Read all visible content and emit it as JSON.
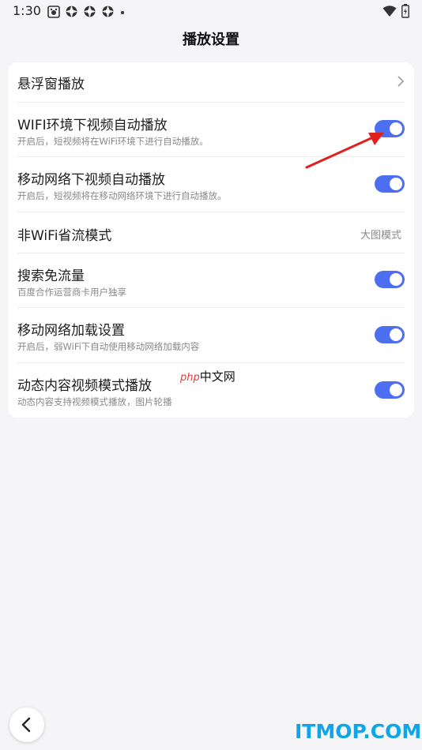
{
  "status_bar": {
    "time": "1:30",
    "icons": [
      "app-notification-icon",
      "gear-notification-icon",
      "gear-notification-icon",
      "gear-notification-icon",
      "more-dot-icon"
    ],
    "right_icons": [
      "wifi-icon",
      "battery-icon"
    ]
  },
  "header": {
    "title": "播放设置"
  },
  "settings": {
    "floating_window": {
      "title": "悬浮窗播放"
    },
    "wifi_autoplay": {
      "title": "WIFI环境下视频自动播放",
      "subtitle": "开启后，短视频将在WiFi环境下进行自动播放。",
      "enabled": true
    },
    "mobile_autoplay": {
      "title": "移动网络下视频自动播放",
      "subtitle": "开启后，短视频将在移动网络环境下进行自动播放。",
      "enabled": true
    },
    "data_saving": {
      "title": "非WiFi省流模式",
      "value": "大图模式"
    },
    "search_free_data": {
      "title": "搜索免流量",
      "subtitle": "百度合作运营商卡用户独享",
      "enabled": true
    },
    "mobile_loading": {
      "title": "移动网络加载设置",
      "subtitle": "开启后，弱WiFi下自动使用移动网络加载内容",
      "enabled": true
    },
    "dynamic_video_mode": {
      "title": "动态内容视频模式播放",
      "subtitle": "动态内容支持视频模式播放，图片轮播",
      "enabled": true
    }
  },
  "watermarks": {
    "php_prefix": "php",
    "php_suffix": "中文网",
    "itmop": "ITMOP.COM"
  },
  "colors": {
    "toggle_on": "#4e6ef2",
    "arrow": "#e0201e",
    "itmop": "#10a5e8"
  }
}
